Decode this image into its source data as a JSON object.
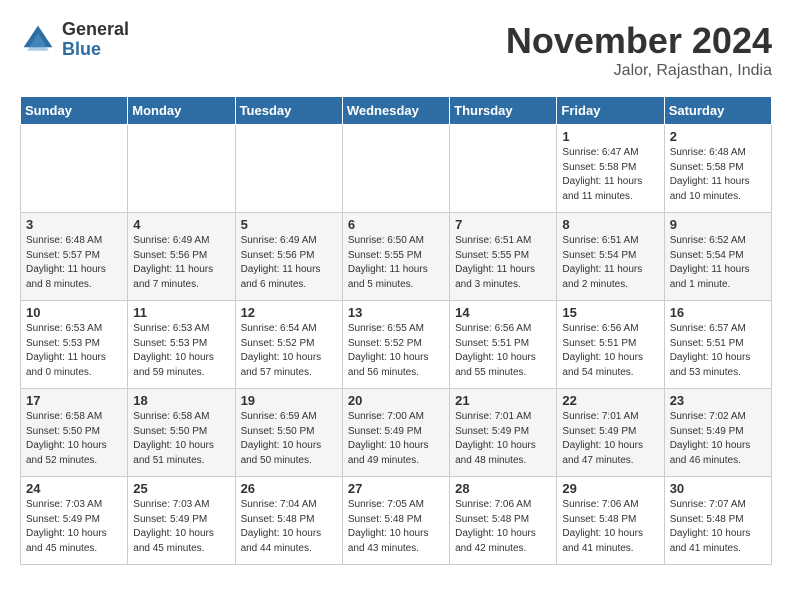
{
  "logo": {
    "general": "General",
    "blue": "Blue"
  },
  "title": "November 2024",
  "location": "Jalor, Rajasthan, India",
  "days_of_week": [
    "Sunday",
    "Monday",
    "Tuesday",
    "Wednesday",
    "Thursday",
    "Friday",
    "Saturday"
  ],
  "weeks": [
    [
      {
        "day": "",
        "info": ""
      },
      {
        "day": "",
        "info": ""
      },
      {
        "day": "",
        "info": ""
      },
      {
        "day": "",
        "info": ""
      },
      {
        "day": "",
        "info": ""
      },
      {
        "day": "1",
        "info": "Sunrise: 6:47 AM\nSunset: 5:58 PM\nDaylight: 11 hours\nand 11 minutes."
      },
      {
        "day": "2",
        "info": "Sunrise: 6:48 AM\nSunset: 5:58 PM\nDaylight: 11 hours\nand 10 minutes."
      }
    ],
    [
      {
        "day": "3",
        "info": "Sunrise: 6:48 AM\nSunset: 5:57 PM\nDaylight: 11 hours\nand 8 minutes."
      },
      {
        "day": "4",
        "info": "Sunrise: 6:49 AM\nSunset: 5:56 PM\nDaylight: 11 hours\nand 7 minutes."
      },
      {
        "day": "5",
        "info": "Sunrise: 6:49 AM\nSunset: 5:56 PM\nDaylight: 11 hours\nand 6 minutes."
      },
      {
        "day": "6",
        "info": "Sunrise: 6:50 AM\nSunset: 5:55 PM\nDaylight: 11 hours\nand 5 minutes."
      },
      {
        "day": "7",
        "info": "Sunrise: 6:51 AM\nSunset: 5:55 PM\nDaylight: 11 hours\nand 3 minutes."
      },
      {
        "day": "8",
        "info": "Sunrise: 6:51 AM\nSunset: 5:54 PM\nDaylight: 11 hours\nand 2 minutes."
      },
      {
        "day": "9",
        "info": "Sunrise: 6:52 AM\nSunset: 5:54 PM\nDaylight: 11 hours\nand 1 minute."
      }
    ],
    [
      {
        "day": "10",
        "info": "Sunrise: 6:53 AM\nSunset: 5:53 PM\nDaylight: 11 hours\nand 0 minutes."
      },
      {
        "day": "11",
        "info": "Sunrise: 6:53 AM\nSunset: 5:53 PM\nDaylight: 10 hours\nand 59 minutes."
      },
      {
        "day": "12",
        "info": "Sunrise: 6:54 AM\nSunset: 5:52 PM\nDaylight: 10 hours\nand 57 minutes."
      },
      {
        "day": "13",
        "info": "Sunrise: 6:55 AM\nSunset: 5:52 PM\nDaylight: 10 hours\nand 56 minutes."
      },
      {
        "day": "14",
        "info": "Sunrise: 6:56 AM\nSunset: 5:51 PM\nDaylight: 10 hours\nand 55 minutes."
      },
      {
        "day": "15",
        "info": "Sunrise: 6:56 AM\nSunset: 5:51 PM\nDaylight: 10 hours\nand 54 minutes."
      },
      {
        "day": "16",
        "info": "Sunrise: 6:57 AM\nSunset: 5:51 PM\nDaylight: 10 hours\nand 53 minutes."
      }
    ],
    [
      {
        "day": "17",
        "info": "Sunrise: 6:58 AM\nSunset: 5:50 PM\nDaylight: 10 hours\nand 52 minutes."
      },
      {
        "day": "18",
        "info": "Sunrise: 6:58 AM\nSunset: 5:50 PM\nDaylight: 10 hours\nand 51 minutes."
      },
      {
        "day": "19",
        "info": "Sunrise: 6:59 AM\nSunset: 5:50 PM\nDaylight: 10 hours\nand 50 minutes."
      },
      {
        "day": "20",
        "info": "Sunrise: 7:00 AM\nSunset: 5:49 PM\nDaylight: 10 hours\nand 49 minutes."
      },
      {
        "day": "21",
        "info": "Sunrise: 7:01 AM\nSunset: 5:49 PM\nDaylight: 10 hours\nand 48 minutes."
      },
      {
        "day": "22",
        "info": "Sunrise: 7:01 AM\nSunset: 5:49 PM\nDaylight: 10 hours\nand 47 minutes."
      },
      {
        "day": "23",
        "info": "Sunrise: 7:02 AM\nSunset: 5:49 PM\nDaylight: 10 hours\nand 46 minutes."
      }
    ],
    [
      {
        "day": "24",
        "info": "Sunrise: 7:03 AM\nSunset: 5:49 PM\nDaylight: 10 hours\nand 45 minutes."
      },
      {
        "day": "25",
        "info": "Sunrise: 7:03 AM\nSunset: 5:49 PM\nDaylight: 10 hours\nand 45 minutes."
      },
      {
        "day": "26",
        "info": "Sunrise: 7:04 AM\nSunset: 5:48 PM\nDaylight: 10 hours\nand 44 minutes."
      },
      {
        "day": "27",
        "info": "Sunrise: 7:05 AM\nSunset: 5:48 PM\nDaylight: 10 hours\nand 43 minutes."
      },
      {
        "day": "28",
        "info": "Sunrise: 7:06 AM\nSunset: 5:48 PM\nDaylight: 10 hours\nand 42 minutes."
      },
      {
        "day": "29",
        "info": "Sunrise: 7:06 AM\nSunset: 5:48 PM\nDaylight: 10 hours\nand 41 minutes."
      },
      {
        "day": "30",
        "info": "Sunrise: 7:07 AM\nSunset: 5:48 PM\nDaylight: 10 hours\nand 41 minutes."
      }
    ]
  ]
}
